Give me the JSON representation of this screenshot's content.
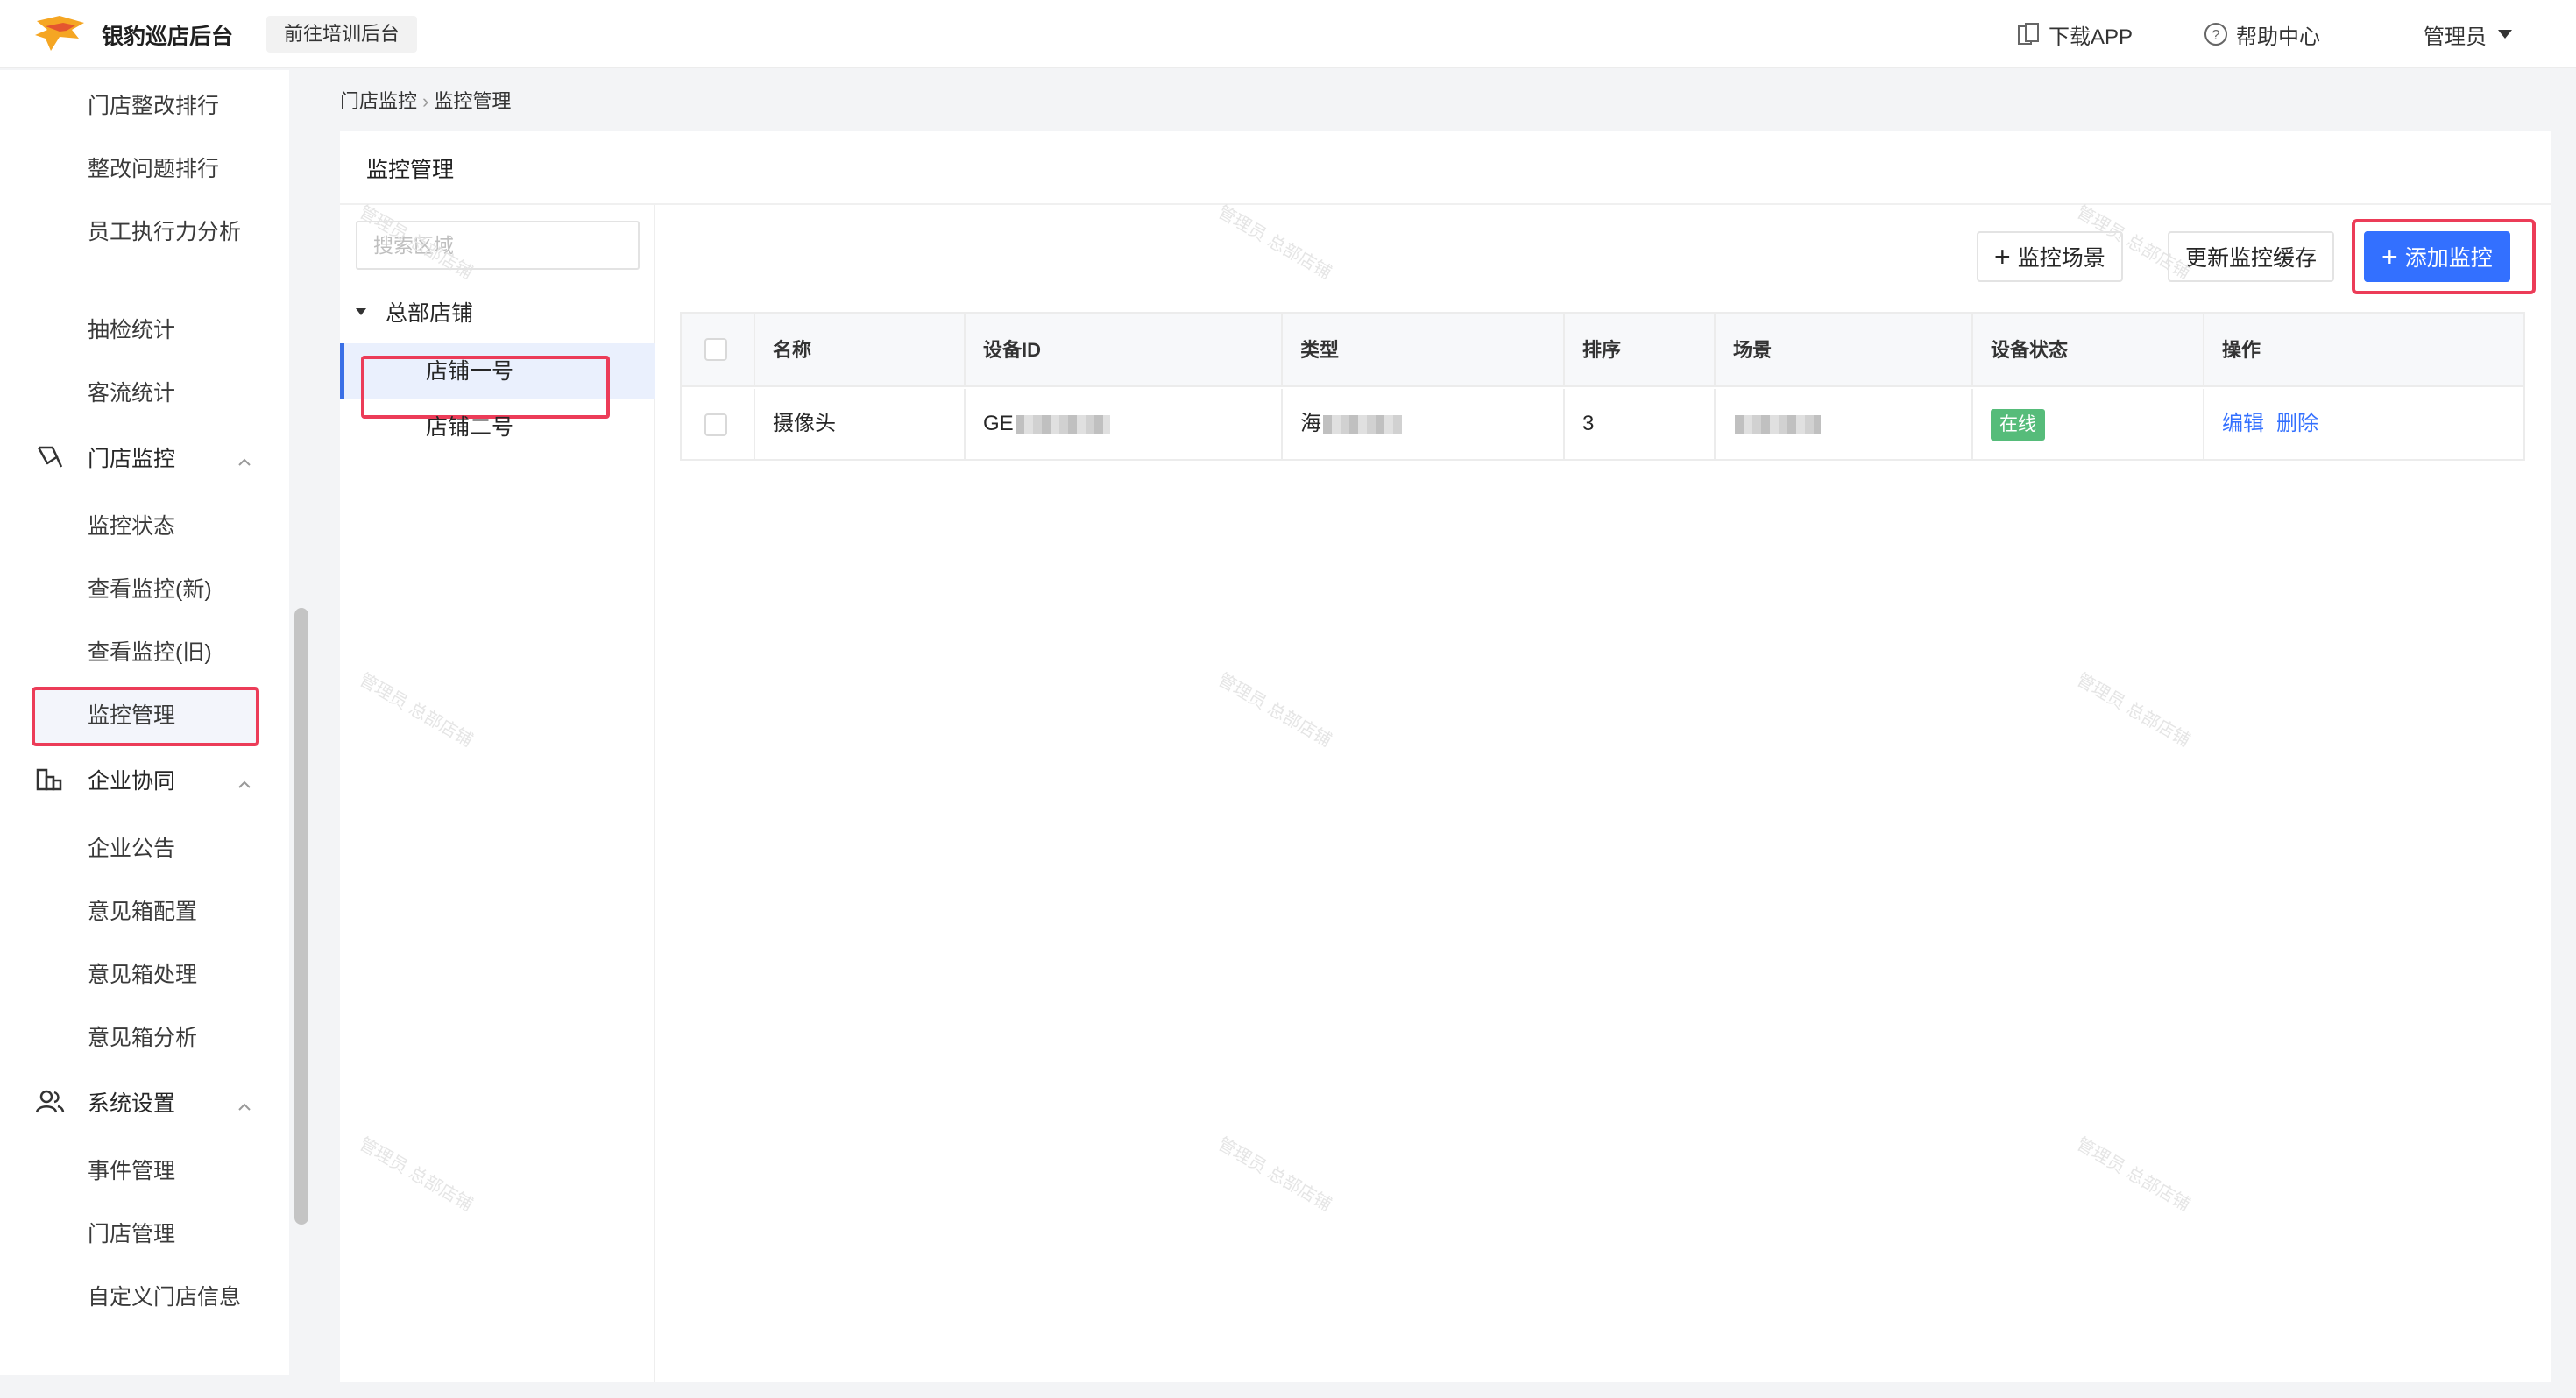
{
  "header": {
    "app_title": "银豹巡店后台",
    "training_link": "前往培训后台",
    "download_app": "下载APP",
    "help_center": "帮助中心",
    "user": "管理员"
  },
  "sidebar": {
    "items_top": [
      "门店整改排行",
      "整改问题排行",
      "员工执行力分析",
      "抽检统计",
      "客流统计"
    ],
    "group_monitor": {
      "label": "门店监控",
      "items": [
        "监控状态",
        "查看监控(新)",
        "查看监控(旧)",
        "监控管理"
      ]
    },
    "group_collab": {
      "label": "企业协同",
      "items": [
        "企业公告",
        "意见箱配置",
        "意见箱处理",
        "意见箱分析"
      ]
    },
    "group_settings": {
      "label": "系统设置",
      "items": [
        "事件管理",
        "门店管理",
        "自定义门店信息"
      ]
    }
  },
  "breadcrumb": {
    "parent": "门店监控",
    "current": "监控管理"
  },
  "panel": {
    "title": "监控管理",
    "tree": {
      "search_placeholder": "搜索区域",
      "root": "总部店铺",
      "children": [
        "店铺一号",
        "店铺二号"
      ]
    },
    "buttons": {
      "scene": "监控场景",
      "refresh_cache": "更新监控缓存",
      "add": "添加监控"
    }
  },
  "table": {
    "columns": [
      "名称",
      "设备ID",
      "类型",
      "排序",
      "场景",
      "设备状态",
      "操作"
    ],
    "rows": [
      {
        "name": "摄像头",
        "device_id_prefix": "GE",
        "type_prefix": "海",
        "order": "3",
        "scene": "",
        "status": "在线",
        "actions": [
          "编辑",
          "删除"
        ]
      }
    ]
  },
  "watermark": "管理员 总部店铺",
  "colors": {
    "primary": "#3370ff",
    "highlight": "#ec3c58",
    "online": "#56bc7a"
  }
}
